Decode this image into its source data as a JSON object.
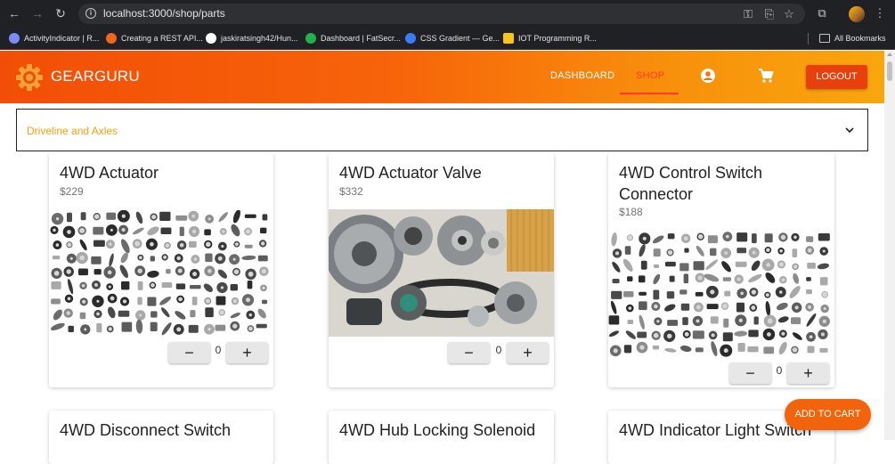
{
  "browser": {
    "url": "localhost:3000/shop/parts",
    "bookmarks": [
      {
        "label": "ActivityIndicator | R...",
        "color": "#7c8cff"
      },
      {
        "label": "Creating a REST API...",
        "color": "#f2641f"
      },
      {
        "label": "jaskiratsingh42/Hun...",
        "color": "#ffffff"
      },
      {
        "label": "Dashboard | FatSecr...",
        "color": "#22b14c"
      },
      {
        "label": "CSS Gradient — Ge...",
        "color": "#3b7bf6"
      },
      {
        "label": "IOT Programming R...",
        "color": "#f5c518"
      }
    ],
    "all_bookmarks": "All Bookmarks"
  },
  "header": {
    "brand": "GEARGURU",
    "nav": {
      "dashboard": "DASHBOARD",
      "shop": "SHOP"
    },
    "logout": "LOGOUT",
    "gradient_start": "#f24e07",
    "gradient_end": "#f9a60d"
  },
  "category": {
    "selected": "Driveline and Axles",
    "accent": "#f59e0b"
  },
  "products": [
    {
      "name": "4WD Actuator",
      "price": "$229",
      "qty": "0",
      "image": "parts-collage"
    },
    {
      "name": "4WD Actuator Valve",
      "price": "$332",
      "qty": "0",
      "image": "brake-parts-photo"
    },
    {
      "name": "4WD Control Switch Connector",
      "price": "$188",
      "qty": "0",
      "image": "parts-collage"
    },
    {
      "name": "4WD Disconnect Switch"
    },
    {
      "name": "4WD Hub Locking Solenoid"
    },
    {
      "name": "4WD Indicator Light Switch"
    }
  ],
  "qty_controls": {
    "minus": "−",
    "plus": "+"
  },
  "cart_button": "ADD TO CART"
}
